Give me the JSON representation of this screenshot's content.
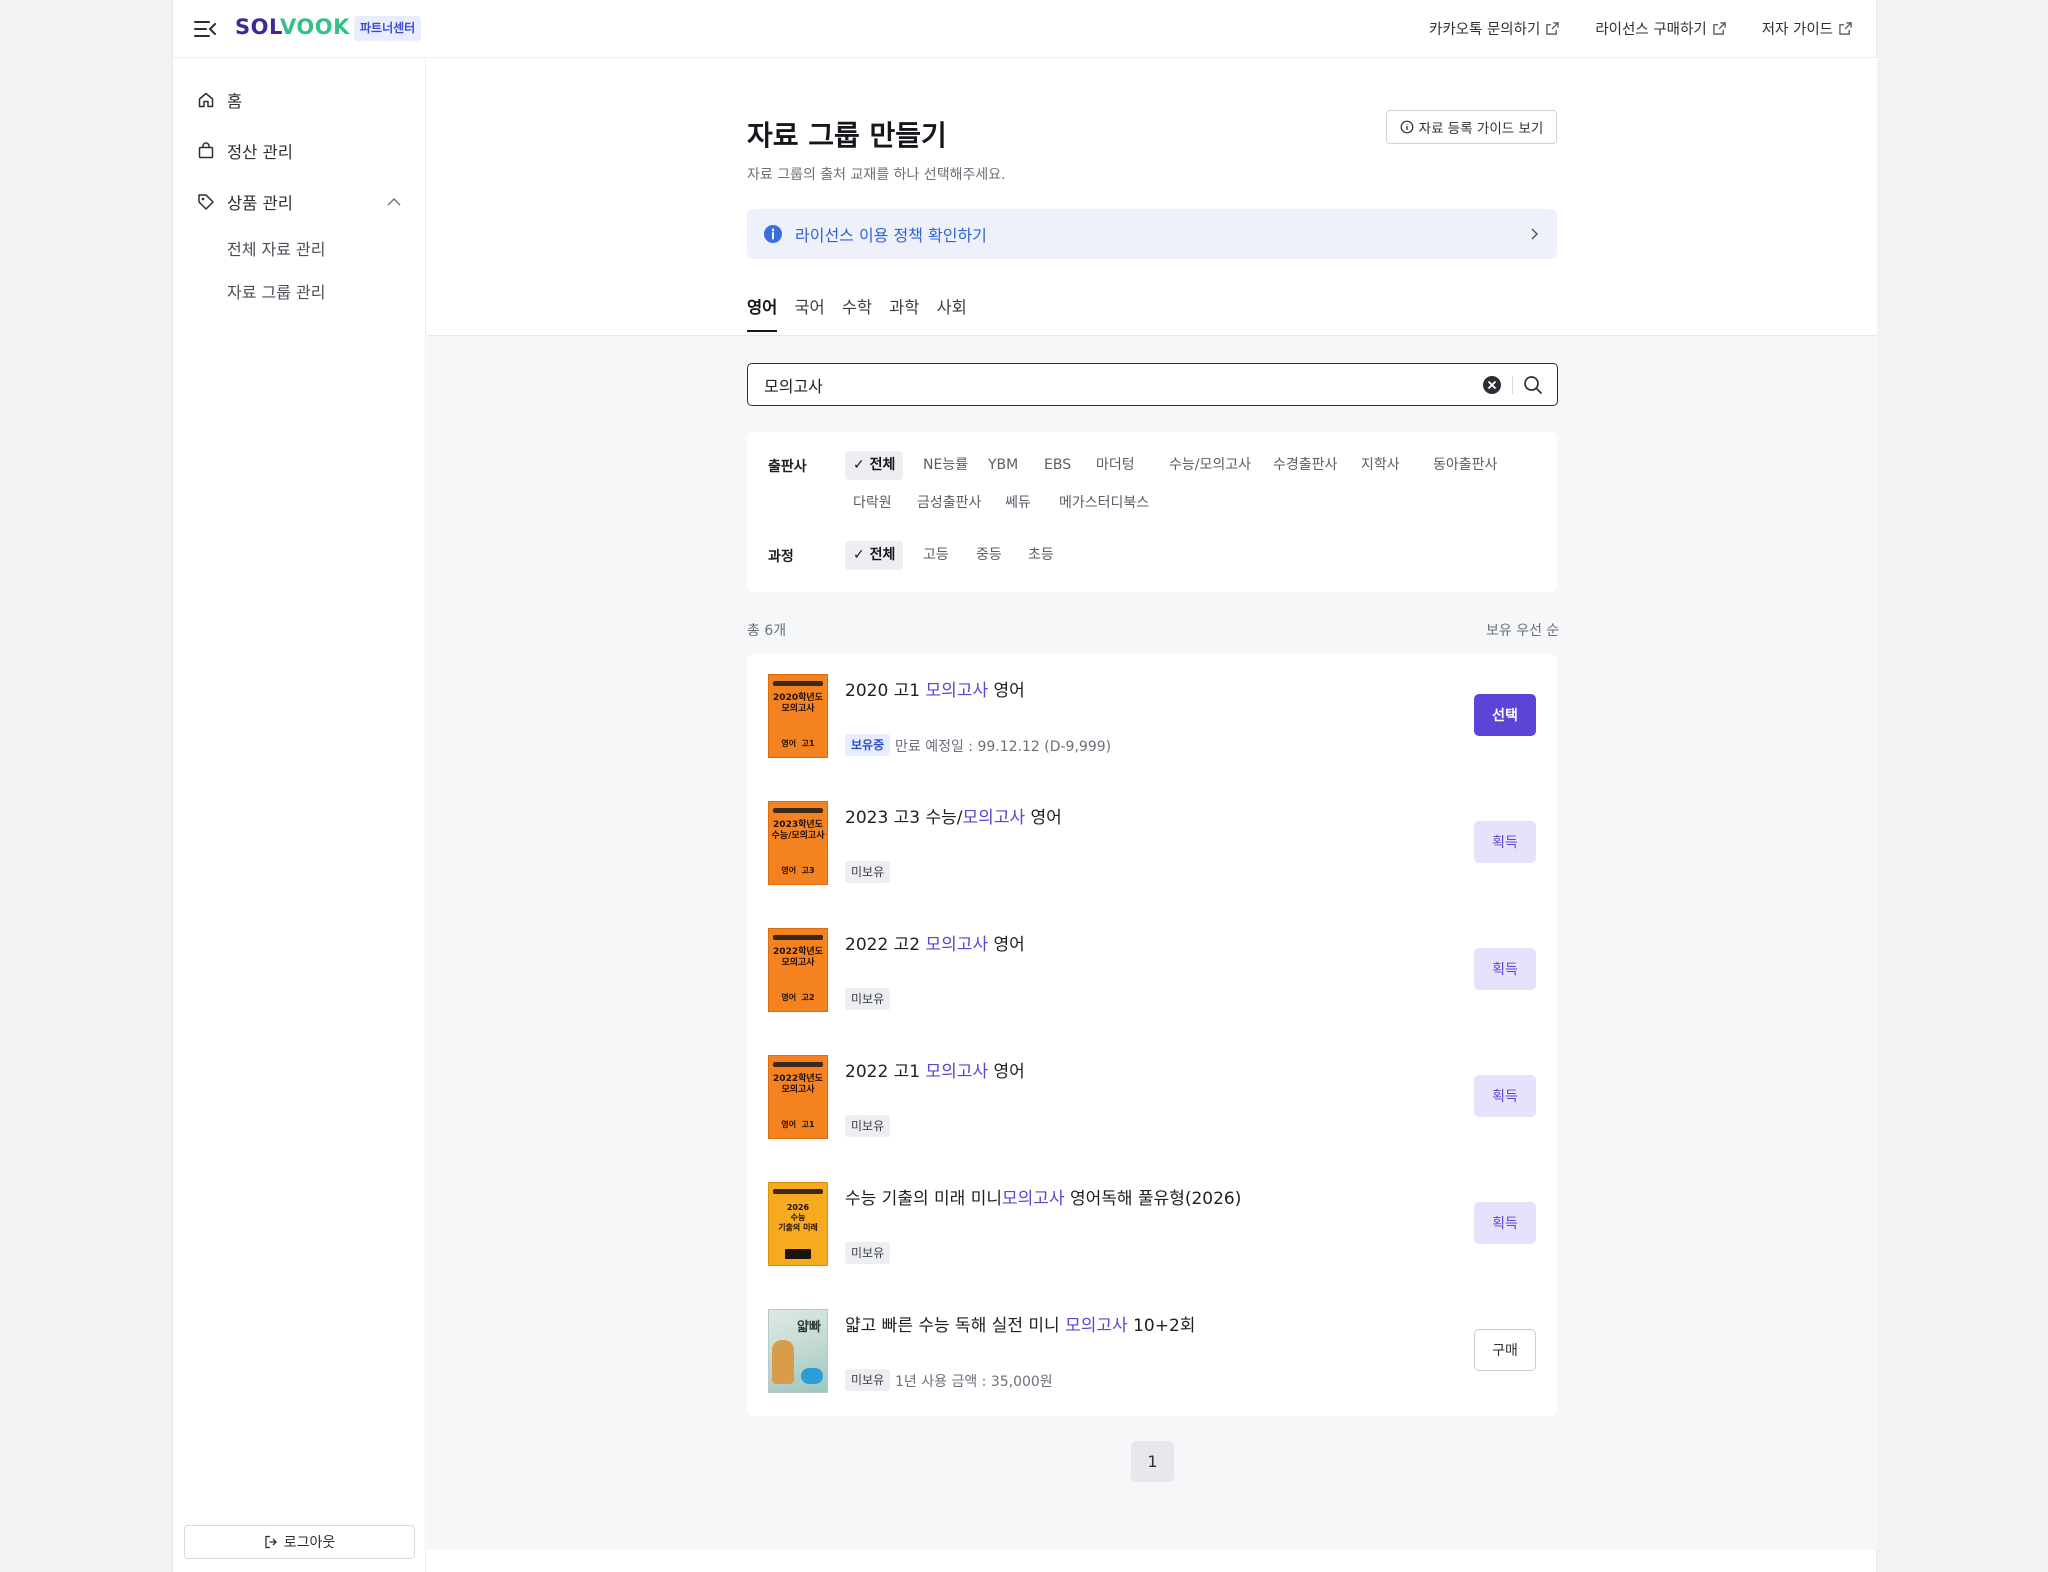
{
  "header": {
    "logo_left": "SOL",
    "logo_v": "V",
    "logo_right": "OOK",
    "partner_badge": "파트너센터",
    "links": [
      "카카오톡 문의하기",
      "라이선스 구매하기",
      "저자 가이드"
    ]
  },
  "sidebar": {
    "home": "홈",
    "settlement": "정산 관리",
    "product": "상품 관리",
    "sub_all": "전체 자료 관리",
    "sub_group": "자료 그룹 관리",
    "logout": "로그아웃"
  },
  "page": {
    "title": "자료 그룹 만들기",
    "subtitle": "자료 그룹의 출처 교재를 하나 선택해주세요.",
    "guide_button": "자료 등록 가이드 보기",
    "license_notice": "라이선스 이용 정책 확인하기"
  },
  "tabs": [
    "영어",
    "국어",
    "수학",
    "과학",
    "사회"
  ],
  "search": {
    "value": "모의고사"
  },
  "filters": {
    "publisher_label": "출판사",
    "publishers": [
      "전체",
      "NE능률",
      "YBM",
      "EBS",
      "마더텅",
      "수능/모의고사",
      "수경출판사",
      "지학사",
      "동아출판사",
      "다락원",
      "금성출판사",
      "쎄듀",
      "메가스터디북스"
    ],
    "course_label": "과정",
    "courses": [
      "전체",
      "고등",
      "중등",
      "초등"
    ]
  },
  "results": {
    "count": "총 6개",
    "sort": "보유 우선 순",
    "items": [
      {
        "pre": "2020 고1 ",
        "hl": "모의고사",
        "post": " 영어",
        "status": "보유중",
        "meta": "만료 예정일 : 99.12.12 (D-9,999)",
        "action": "선택",
        "cover_title": "2020학년도\n모의고사",
        "cover_foot": "영어  고1"
      },
      {
        "pre": "2023 고3 수능/",
        "hl": "모의고사",
        "post": " 영어",
        "status": "미보유",
        "meta": "",
        "action": "획득",
        "cover_title": "2023학년도\n수능/모의고사",
        "cover_foot": "영어  고3"
      },
      {
        "pre": "2022 고2 ",
        "hl": "모의고사",
        "post": " 영어",
        "status": "미보유",
        "meta": "",
        "action": "획득",
        "cover_title": "2022학년도\n모의고사",
        "cover_foot": "영어  고2"
      },
      {
        "pre": "2022 고1 ",
        "hl": "모의고사",
        "post": " 영어",
        "status": "미보유",
        "meta": "",
        "action": "획득",
        "cover_title": "2022학년도\n모의고사",
        "cover_foot": "영어  고1"
      },
      {
        "pre": "수능 기출의 미래 미니",
        "hl": "모의고사",
        "post": " 영어독해 풀유형(2026)",
        "status": "미보유",
        "meta": "",
        "action": "획득",
        "cover_title": "2026\n수능\n기출의 미래"
      },
      {
        "pre": "얇고 빠른 수능 독해 실전 미니 ",
        "hl": "모의고사",
        "post": " 10+2회",
        "status": "미보유",
        "meta": "1년 사용 금액 : 35,000원",
        "action": "구매",
        "cover_title": "얇빠"
      }
    ]
  },
  "pagination": {
    "current": "1"
  },
  "colors": {
    "accent": "#5b44d6",
    "info": "#2f62d6"
  }
}
